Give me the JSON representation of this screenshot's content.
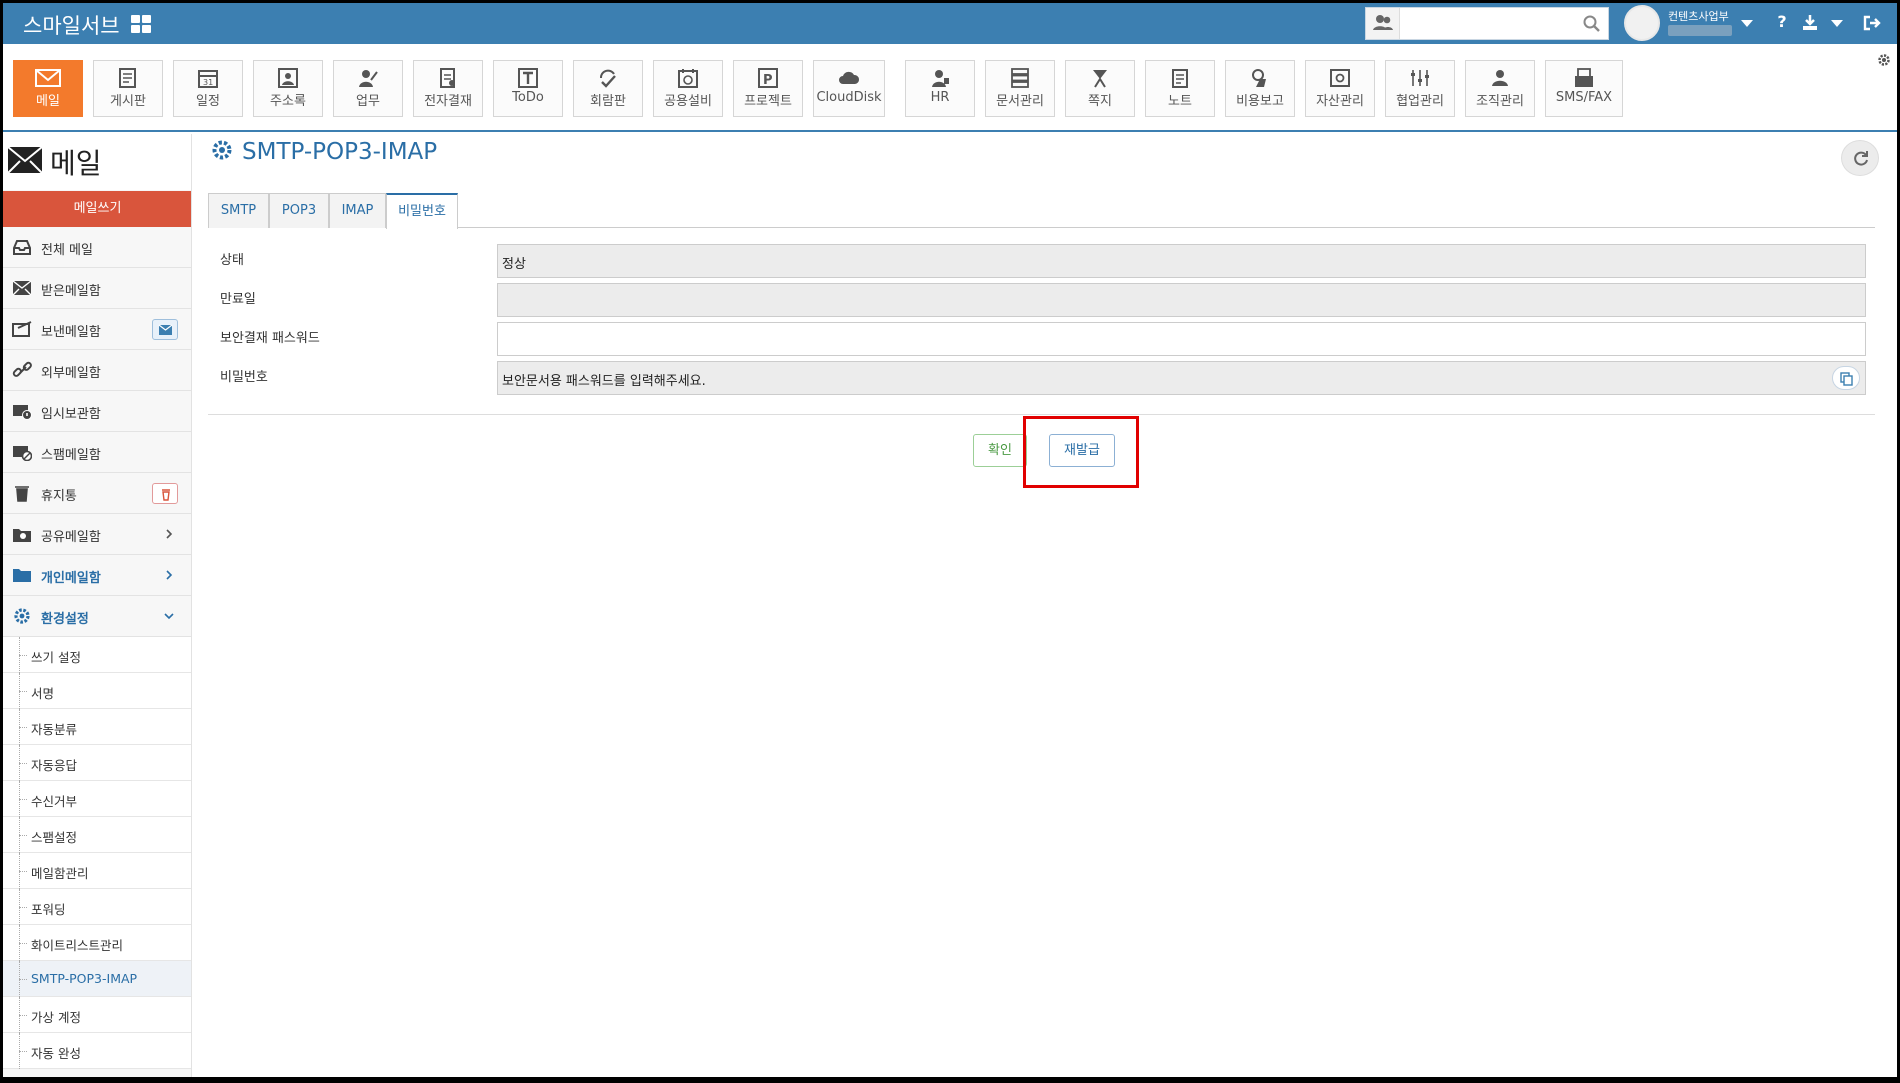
{
  "topbar": {
    "brand": "스마일서브",
    "search_placeholder": "",
    "user_name": "컨텐츠사업부"
  },
  "apps": [
    {
      "label": "메일",
      "icon": "mail-icon",
      "active": true
    },
    {
      "label": "게시판",
      "icon": "board-icon"
    },
    {
      "label": "일정",
      "icon": "calendar-icon"
    },
    {
      "label": "주소록",
      "icon": "contacts-icon"
    },
    {
      "label": "업무",
      "icon": "task-icon"
    },
    {
      "label": "전자결재",
      "icon": "approval-icon"
    },
    {
      "label": "ToDo",
      "icon": "todo-icon"
    },
    {
      "label": "회람판",
      "icon": "circular-icon"
    },
    {
      "label": "공용설비",
      "icon": "facility-icon"
    },
    {
      "label": "프로젝트",
      "icon": "project-icon"
    },
    {
      "label": "CloudDisk",
      "icon": "cloud-icon"
    },
    {
      "label": "HR",
      "icon": "hr-icon"
    },
    {
      "label": "문서관리",
      "icon": "document-icon"
    },
    {
      "label": "쪽지",
      "icon": "note-icon"
    },
    {
      "label": "노트",
      "icon": "memo-icon"
    },
    {
      "label": "비용보고",
      "icon": "expense-icon"
    },
    {
      "label": "자산관리",
      "icon": "asset-icon"
    },
    {
      "label": "협업관리",
      "icon": "collab-icon"
    },
    {
      "label": "조직관리",
      "icon": "org-icon"
    },
    {
      "label": "SMS/FAX",
      "icon": "sms-fax-icon"
    }
  ],
  "sidebar": {
    "title": "메일",
    "compose": "메일쓰기",
    "items": [
      {
        "label": "전체 메일"
      },
      {
        "label": "받은메일함"
      },
      {
        "label": "보낸메일함"
      },
      {
        "label": "외부메일함"
      },
      {
        "label": "임시보관함"
      },
      {
        "label": "스팸메일함"
      },
      {
        "label": "휴지통"
      },
      {
        "label": "공유메일함"
      },
      {
        "label": "개인메일함"
      },
      {
        "label": "환경설정"
      }
    ],
    "settings": [
      {
        "label": "쓰기 설정"
      },
      {
        "label": "서명"
      },
      {
        "label": "자동분류"
      },
      {
        "label": "자동응답"
      },
      {
        "label": "수신거부"
      },
      {
        "label": "스팸설정"
      },
      {
        "label": "메일함관리"
      },
      {
        "label": "포워딩"
      },
      {
        "label": "화이트리스트관리"
      },
      {
        "label": "SMTP-POP3-IMAP"
      },
      {
        "label": "가상 계정"
      },
      {
        "label": "자동 완성"
      }
    ]
  },
  "main": {
    "title": "SMTP-POP3-IMAP",
    "tabs": [
      {
        "label": "SMTP"
      },
      {
        "label": "POP3"
      },
      {
        "label": "IMAP"
      },
      {
        "label": "비밀번호"
      }
    ],
    "rows": [
      {
        "label": "상태",
        "value": "정상"
      },
      {
        "label": "만료일",
        "value": ""
      },
      {
        "label": "보안결재 패스워드",
        "value": ""
      },
      {
        "label": "비밀번호",
        "value": "보안문서용 패스워드를 입력해주세요."
      }
    ],
    "buttons": {
      "ok": "확인",
      "reissue": "재발급"
    }
  },
  "colors": {
    "brand": "#3c7fb1",
    "compose": "#d9553c",
    "active_app": "#f37a2c",
    "highlight": "#e10000"
  }
}
